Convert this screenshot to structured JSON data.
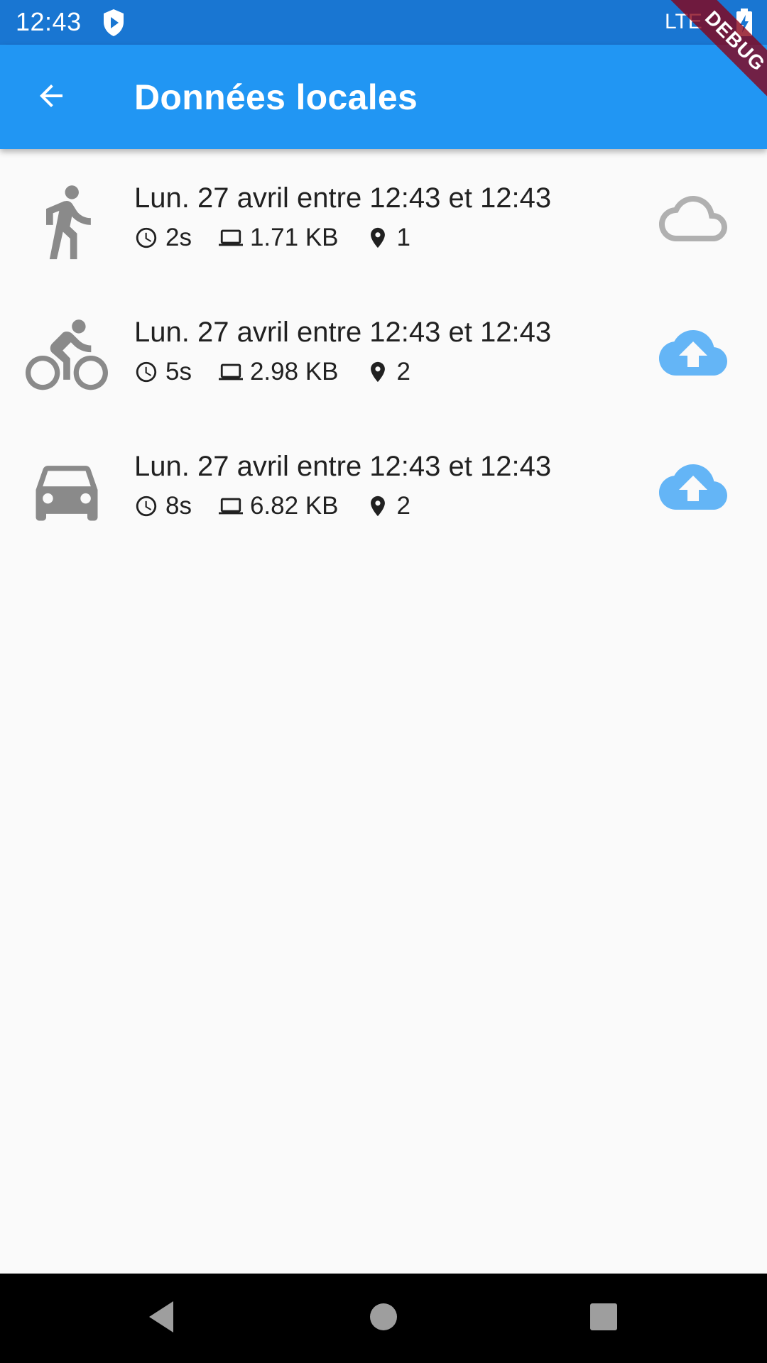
{
  "status_bar": {
    "time": "12:43",
    "network": "LTE",
    "shield_icon": "shield-play-icon",
    "battery_icon": "battery-charging-icon"
  },
  "app_bar": {
    "title": "Données locales",
    "back_icon": "arrow-back-icon",
    "background": "#2196f3"
  },
  "debug_banner": "DEBUG",
  "trips": [
    {
      "mode_icon": "walk-icon",
      "title": "Lun. 27 avril entre 12:43 et 12:43",
      "duration": "2s",
      "size": "1.71 KB",
      "points": "1",
      "upload_icon": "cloud-outline-icon"
    },
    {
      "mode_icon": "bike-icon",
      "title": "Lun. 27 avril entre 12:43 et 12:43",
      "duration": "5s",
      "size": "2.98 KB",
      "points": "2",
      "upload_icon": "cloud-upload-icon"
    },
    {
      "mode_icon": "car-icon",
      "title": "Lun. 27 avril entre 12:43 et 12:43",
      "duration": "8s",
      "size": "6.82 KB",
      "points": "2",
      "upload_icon": "cloud-upload-icon"
    }
  ],
  "colors": {
    "status_bar": "#1976d2",
    "mode_icon": "#8a8a8a",
    "upload_active": "#64b5f6",
    "upload_inactive": "#b0b0b0"
  }
}
